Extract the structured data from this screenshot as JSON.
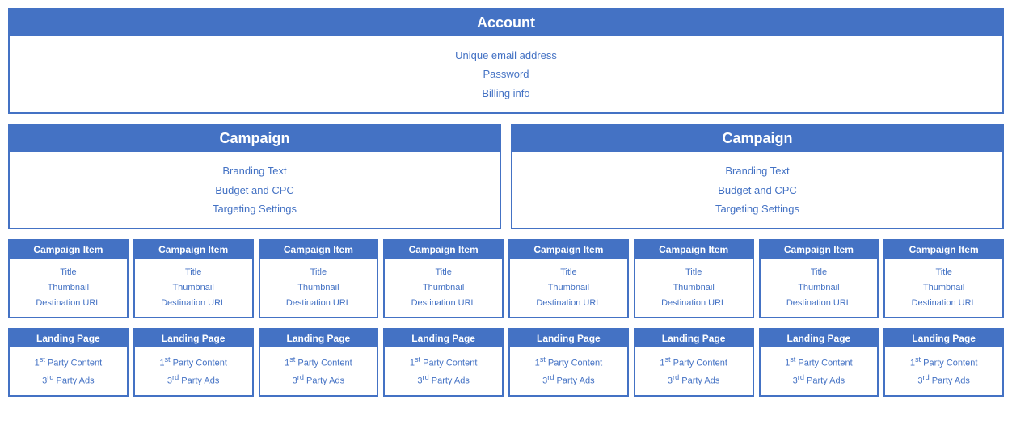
{
  "account": {
    "header": "Account",
    "items": [
      "Unique email address",
      "Password",
      "Billing info"
    ]
  },
  "campaigns": [
    {
      "header": "Campaign",
      "items": [
        "Branding Text",
        "Budget and CPC",
        "Targeting Settings"
      ]
    },
    {
      "header": "Campaign",
      "items": [
        "Branding Text",
        "Budget and CPC",
        "Targeting Settings"
      ]
    }
  ],
  "campaignItems": [
    {
      "header": "Campaign Item",
      "fields": [
        "Title",
        "Thumbnail",
        "Destination URL"
      ]
    },
    {
      "header": "Campaign Item",
      "fields": [
        "Title",
        "Thumbnail",
        "Destination URL"
      ]
    },
    {
      "header": "Campaign Item",
      "fields": [
        "Title",
        "Thumbnail",
        "Destination URL"
      ]
    },
    {
      "header": "Campaign Item",
      "fields": [
        "Title",
        "Thumbnail",
        "Destination URL"
      ]
    },
    {
      "header": "Campaign Item",
      "fields": [
        "Title",
        "Thumbnail",
        "Destination URL"
      ]
    },
    {
      "header": "Campaign Item",
      "fields": [
        "Title",
        "Thumbnail",
        "Destination URL"
      ]
    },
    {
      "header": "Campaign Item",
      "fields": [
        "Title",
        "Thumbnail",
        "Destination URL"
      ]
    },
    {
      "header": "Campaign Item",
      "fields": [
        "Title",
        "Thumbnail",
        "Destination URL"
      ]
    }
  ],
  "landingPages": [
    {
      "header": "Landing Page",
      "fields": [
        "1st Party Content",
        "3rd Party Ads"
      ]
    },
    {
      "header": "Landing Page",
      "fields": [
        "1st Party Content",
        "3rd Party Ads"
      ]
    },
    {
      "header": "Landing Page",
      "fields": [
        "1st Party Content",
        "3rd Party Ads"
      ]
    },
    {
      "header": "Landing Page",
      "fields": [
        "1st Party Content",
        "3rd Party Ads"
      ]
    },
    {
      "header": "Landing Page",
      "fields": [
        "1st Party Content",
        "3rd Party Ads"
      ]
    },
    {
      "header": "Landing Page",
      "fields": [
        "1st Party Content",
        "3rd Party Ads"
      ]
    },
    {
      "header": "Landing Page",
      "fields": [
        "1st Party Content",
        "3rd Party Ads"
      ]
    },
    {
      "header": "Landing Page",
      "fields": [
        "1st Party Content",
        "3rd Party Ads"
      ]
    }
  ]
}
